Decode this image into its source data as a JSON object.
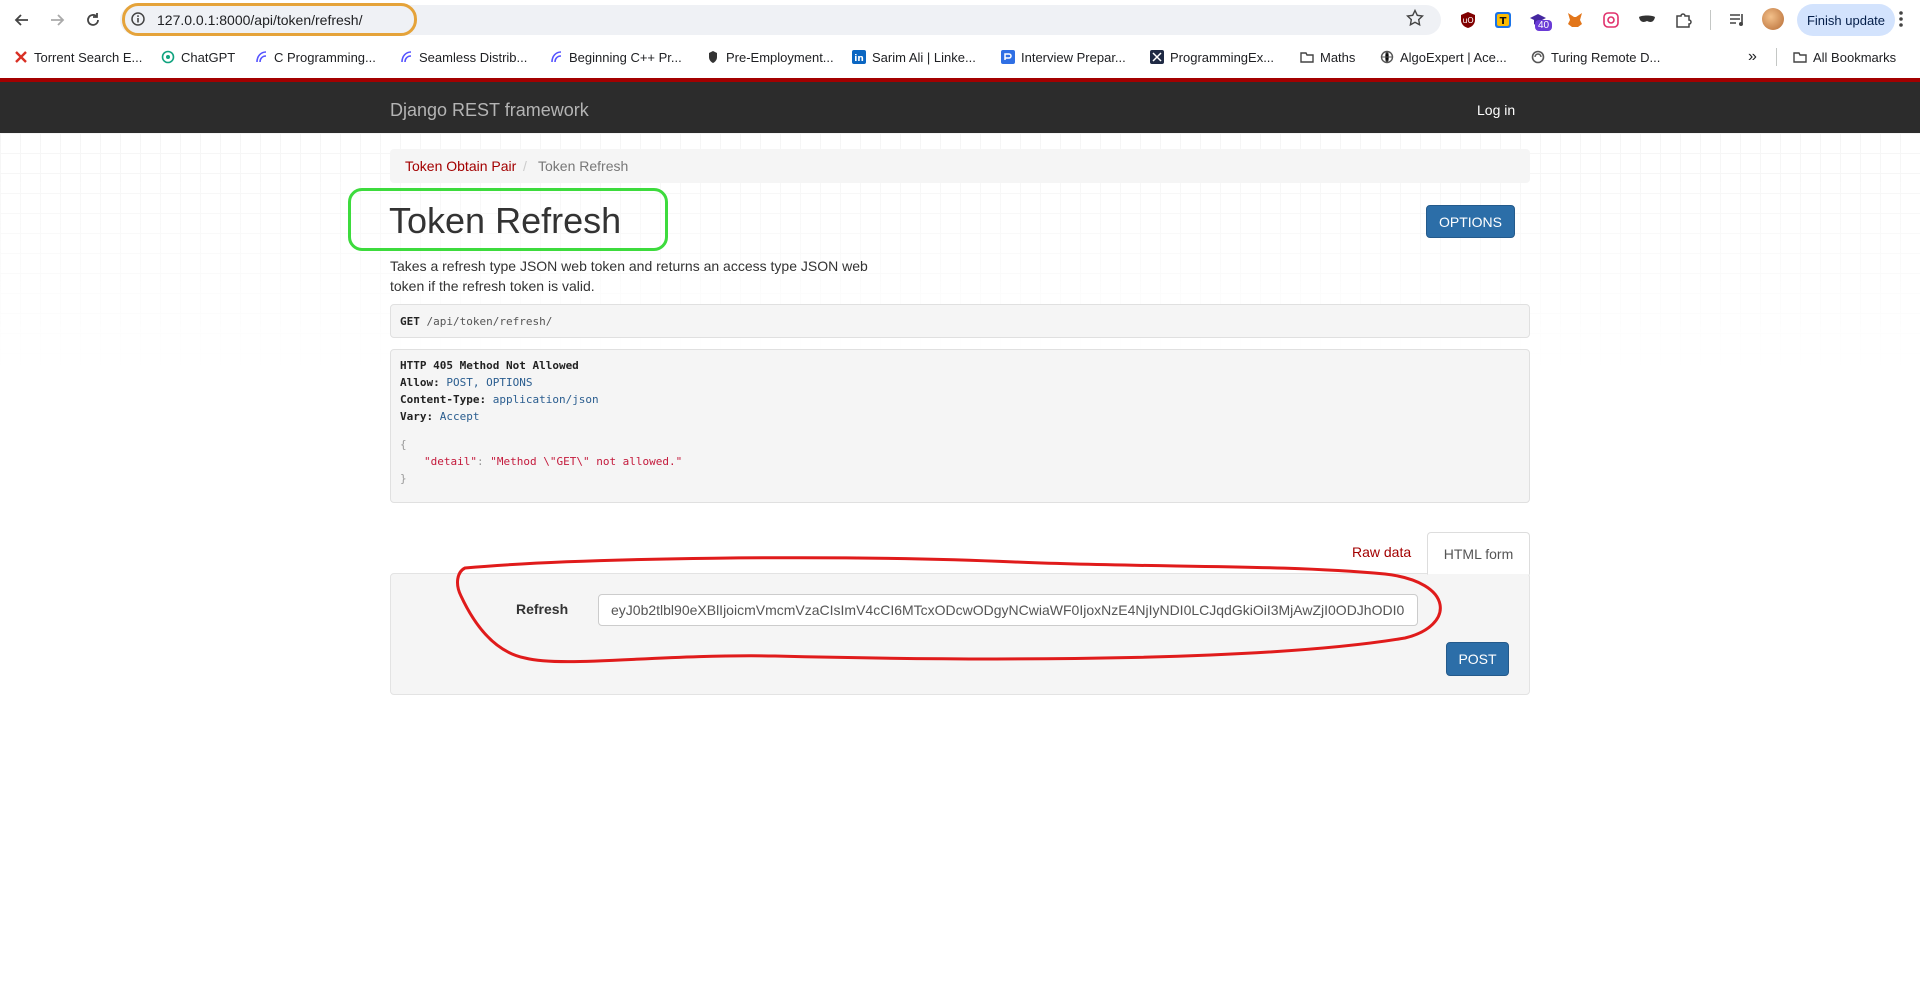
{
  "browser": {
    "url": "127.0.0.1:8000/api/token/refresh/",
    "finish_update": "Finish update",
    "extension_badge": "40",
    "bookmarks": [
      "Torrent Search E...",
      "ChatGPT",
      "C Programming...",
      "Seamless Distrib...",
      "Beginning C++ Pr...",
      "Pre-Employment...",
      "Sarim Ali | Linke...",
      "Interview Prepar...",
      "ProgrammingEx...",
      "Maths",
      "AlgoExpert | Ace...",
      "Turing Remote D..."
    ],
    "more_bookmarks": "»",
    "all_bookmarks": "All Bookmarks"
  },
  "navbar": {
    "brand": "Django REST framework",
    "login": "Log in"
  },
  "breadcrumb": {
    "items": [
      "Token Obtain Pair",
      "Token Refresh"
    ],
    "separator": "/"
  },
  "page": {
    "title": "Token Refresh",
    "options_label": "OPTIONS",
    "description": "Takes a refresh type JSON web token and returns an access type JSON web token if the refresh token is valid."
  },
  "request": {
    "method": "GET",
    "path": "/api/token/refresh/"
  },
  "response": {
    "status": "HTTP 405 Method Not Allowed",
    "allow_key": "Allow:",
    "allow_val": "POST, OPTIONS",
    "ctype_key": "Content-Type:",
    "ctype_val": "application/json",
    "vary_key": "Vary:",
    "vary_val": "Accept",
    "open_brace": "{",
    "detail_key": "\"detail\"",
    "colon": ":",
    "detail_val": "\"Method \\\"GET\\\" not allowed.\"",
    "close_brace": "}"
  },
  "form": {
    "tab_raw": "Raw data",
    "tab_html": "HTML form",
    "field_label": "Refresh",
    "field_value": "eyJ0b2tlbl90eXBlIjoicmVmcmVzaCIsImV4cCI6MTcxODcwODgyNCwiaWF0IjoxNzE4NjIyNDI0LCJqdGkiOiI3MjAwZjI0ODJhODI0",
    "submit_label": "POST"
  },
  "colors": {
    "accent_red": "#a30000",
    "button_blue": "#2c6ea8",
    "url_highlight": "#e5a33a",
    "title_highlight": "#3ddb3d",
    "form_highlight": "#e01b1b"
  }
}
